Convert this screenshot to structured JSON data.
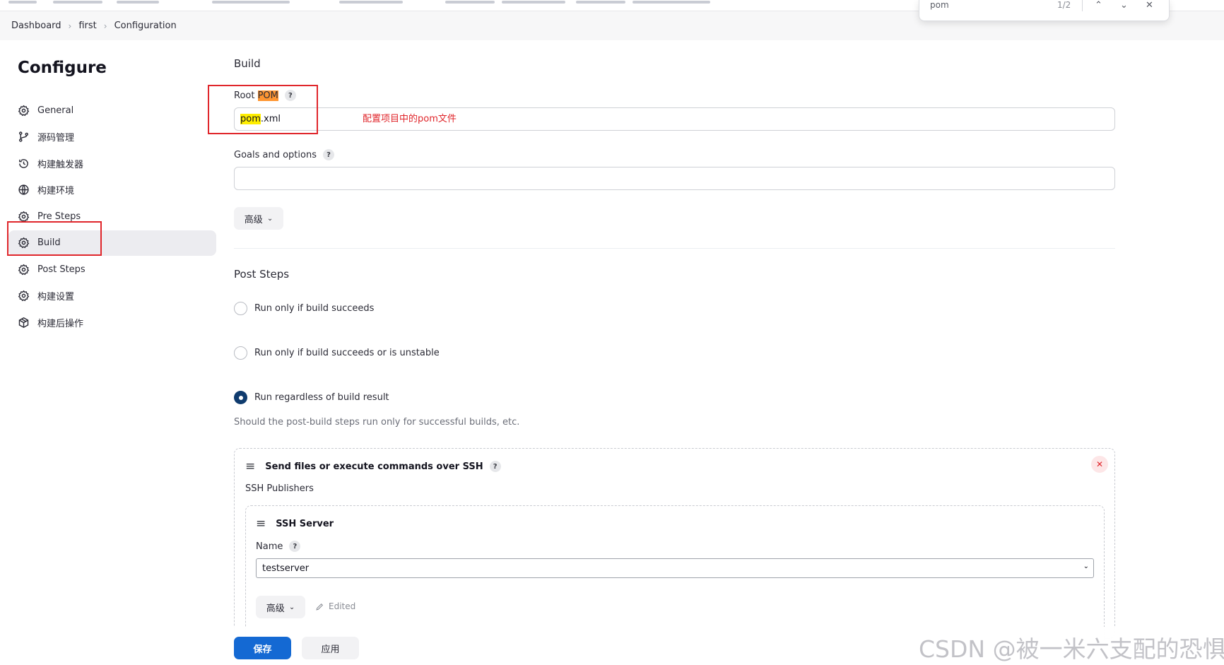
{
  "breadcrumb": {
    "items": [
      "Dashboard",
      "first",
      "Configuration"
    ]
  },
  "find_bar": {
    "query": "pom",
    "count": "1/2"
  },
  "sidebar": {
    "title": "Configure",
    "items": [
      {
        "label": "General",
        "icon": "gear-icon"
      },
      {
        "label": "源码管理",
        "icon": "branch-icon"
      },
      {
        "label": "构建触发器",
        "icon": "clock-icon"
      },
      {
        "label": "构建环境",
        "icon": "globe-icon"
      },
      {
        "label": "Pre Steps",
        "icon": "gear-icon"
      },
      {
        "label": "Build",
        "icon": "gear-icon",
        "active": true
      },
      {
        "label": "Post Steps",
        "icon": "gear-icon"
      },
      {
        "label": "构建设置",
        "icon": "gear-icon"
      },
      {
        "label": "构建后操作",
        "icon": "package-icon"
      }
    ]
  },
  "build": {
    "section_title": "Build",
    "root_pom_label_prefix": "Root ",
    "root_pom_label_match": "POM",
    "root_pom_value_match": "pom",
    "root_pom_value_rest": ".xml",
    "annotation": "配置项目中的pom文件",
    "goals_label": "Goals and options",
    "goals_value": "",
    "advanced_label": "高级"
  },
  "post_steps": {
    "section_title": "Post Steps",
    "options": [
      {
        "label": "Run only if build succeeds",
        "checked": false
      },
      {
        "label": "Run only if build succeeds or is unstable",
        "checked": false
      },
      {
        "label": "Run regardless of build result",
        "checked": true
      }
    ],
    "hint": "Should the post-build steps run only for successful builds, etc."
  },
  "ssh_card": {
    "title": "Send files or execute commands over SSH",
    "publishers_label": "SSH Publishers",
    "server": {
      "title": "SSH Server",
      "name_label": "Name",
      "name_value": "testserver",
      "advanced_label": "高级",
      "edited_label": "Edited"
    }
  },
  "footer": {
    "save_label": "保存",
    "apply_label": "应用"
  },
  "watermark": "CSDN @被一米六支配的恐惧",
  "colors": {
    "primary": "#1469d3",
    "annotation_red": "#e0262b",
    "radio_checked": "#0f3b6e",
    "find_highlight": "#ffee00",
    "find_current": "#ff9632"
  }
}
